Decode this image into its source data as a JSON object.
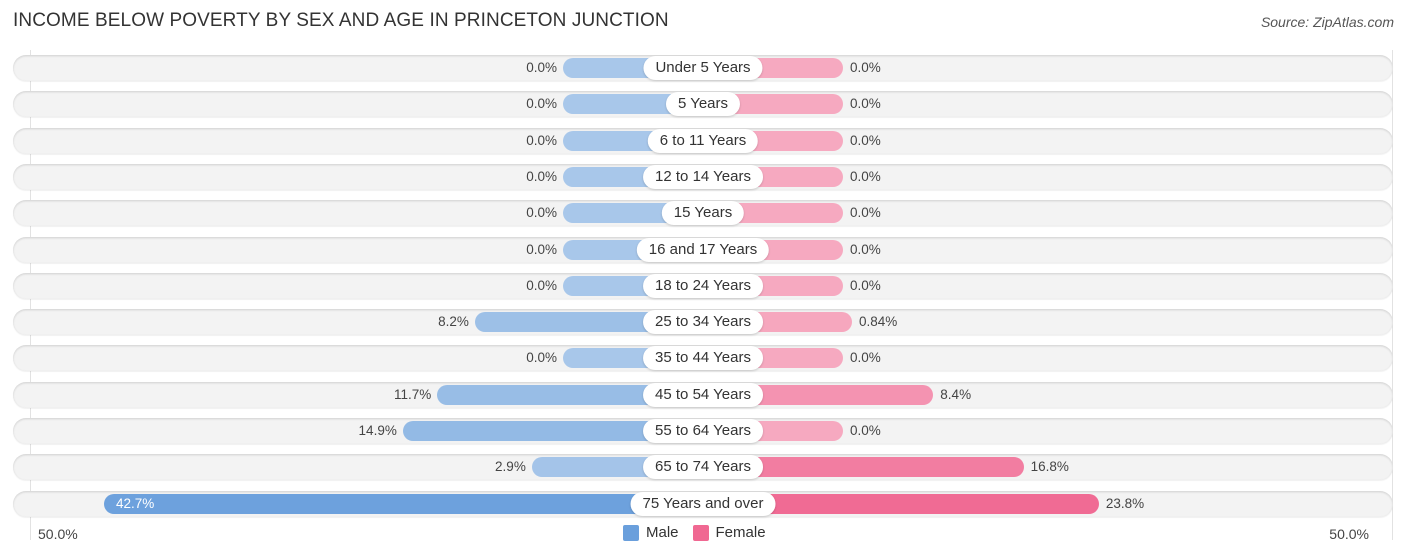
{
  "title": "INCOME BELOW POVERTY BY SEX AND AGE IN PRINCETON JUNCTION",
  "source": "Source: ZipAtlas.com",
  "colors": {
    "male_light": "#a8c7ea",
    "male_strong": "#6a9fdc",
    "female_light": "#f6a9c0",
    "female_strong": "#f06892"
  },
  "chart_data": {
    "type": "bar",
    "orientation": "horizontal-diverging",
    "title": "INCOME BELOW POVERTY BY SEX AND AGE IN PRINCETON JUNCTION",
    "categories": [
      "Under 5 Years",
      "5 Years",
      "6 to 11 Years",
      "12 to 14 Years",
      "15 Years",
      "16 and 17 Years",
      "18 to 24 Years",
      "25 to 34 Years",
      "35 to 44 Years",
      "45 to 54 Years",
      "55 to 64 Years",
      "65 to 74 Years",
      "75 Years and over"
    ],
    "series": [
      {
        "name": "Male",
        "values": [
          0.0,
          0.0,
          0.0,
          0.0,
          0.0,
          0.0,
          0.0,
          8.2,
          0.0,
          11.7,
          14.9,
          2.9,
          42.7
        ],
        "labels": [
          "0.0%",
          "0.0%",
          "0.0%",
          "0.0%",
          "0.0%",
          "0.0%",
          "0.0%",
          "8.2%",
          "0.0%",
          "11.7%",
          "14.9%",
          "2.9%",
          "42.7%"
        ]
      },
      {
        "name": "Female",
        "values": [
          0.0,
          0.0,
          0.0,
          0.0,
          0.0,
          0.0,
          0.0,
          0.84,
          0.0,
          8.4,
          0.0,
          16.8,
          23.8
        ],
        "labels": [
          "0.0%",
          "0.0%",
          "0.0%",
          "0.0%",
          "0.0%",
          "0.0%",
          "0.0%",
          "0.84%",
          "0.0%",
          "8.4%",
          "0.0%",
          "16.8%",
          "23.8%"
        ]
      }
    ],
    "xlim": [
      -50,
      50
    ],
    "axis_labels": {
      "left": "50.0%",
      "right": "50.0%"
    },
    "legend": {
      "position": "bottom-center",
      "entries": [
        "Male",
        "Female"
      ]
    },
    "grid": false
  }
}
